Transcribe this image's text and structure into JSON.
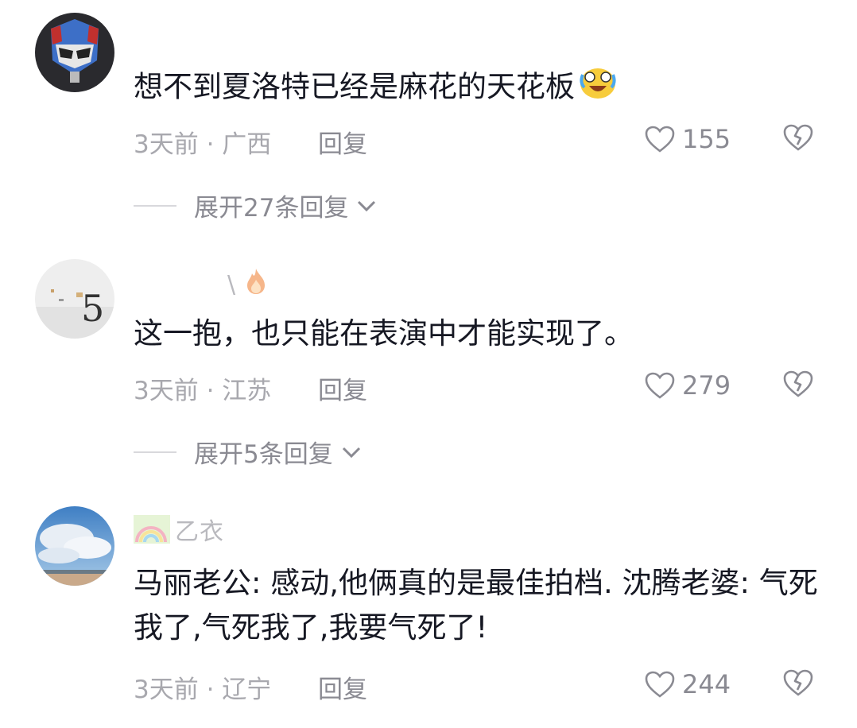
{
  "comments": [
    {
      "username": "",
      "text": "想不到夏洛特已经是麻花的天花板",
      "meta": "3天前 · 广西",
      "reply_label": "回复",
      "likes": "155",
      "expand_label": "展开27条回复",
      "avatar_icon": "helmet-avatar"
    },
    {
      "username": "\\",
      "text": "这一抱，也只能在表演中才能实现了。",
      "meta": "3天前 · 江苏",
      "reply_label": "回复",
      "likes": "279",
      "expand_label": "展开5条回复",
      "avatar_icon": "number-5-avatar"
    },
    {
      "username": "乙衣",
      "text": "马丽老公: 感动,他俩真的是最佳拍档. 沈腾老婆: 气死我了,气死我了,我要气死了!",
      "meta": "3天前 · 辽宁",
      "reply_label": "回复",
      "likes": "244",
      "avatar_icon": "sky-avatar"
    }
  ],
  "icons": {
    "like": "heart-outline-icon",
    "dislike": "broken-heart-icon",
    "expand": "chevron-down-icon",
    "emoji": "crying-laughing-emoji",
    "fire": "fire-emoji"
  },
  "colors": {
    "text": "#161823",
    "meta": "#a8a8ae",
    "action": "#8a8a92"
  }
}
